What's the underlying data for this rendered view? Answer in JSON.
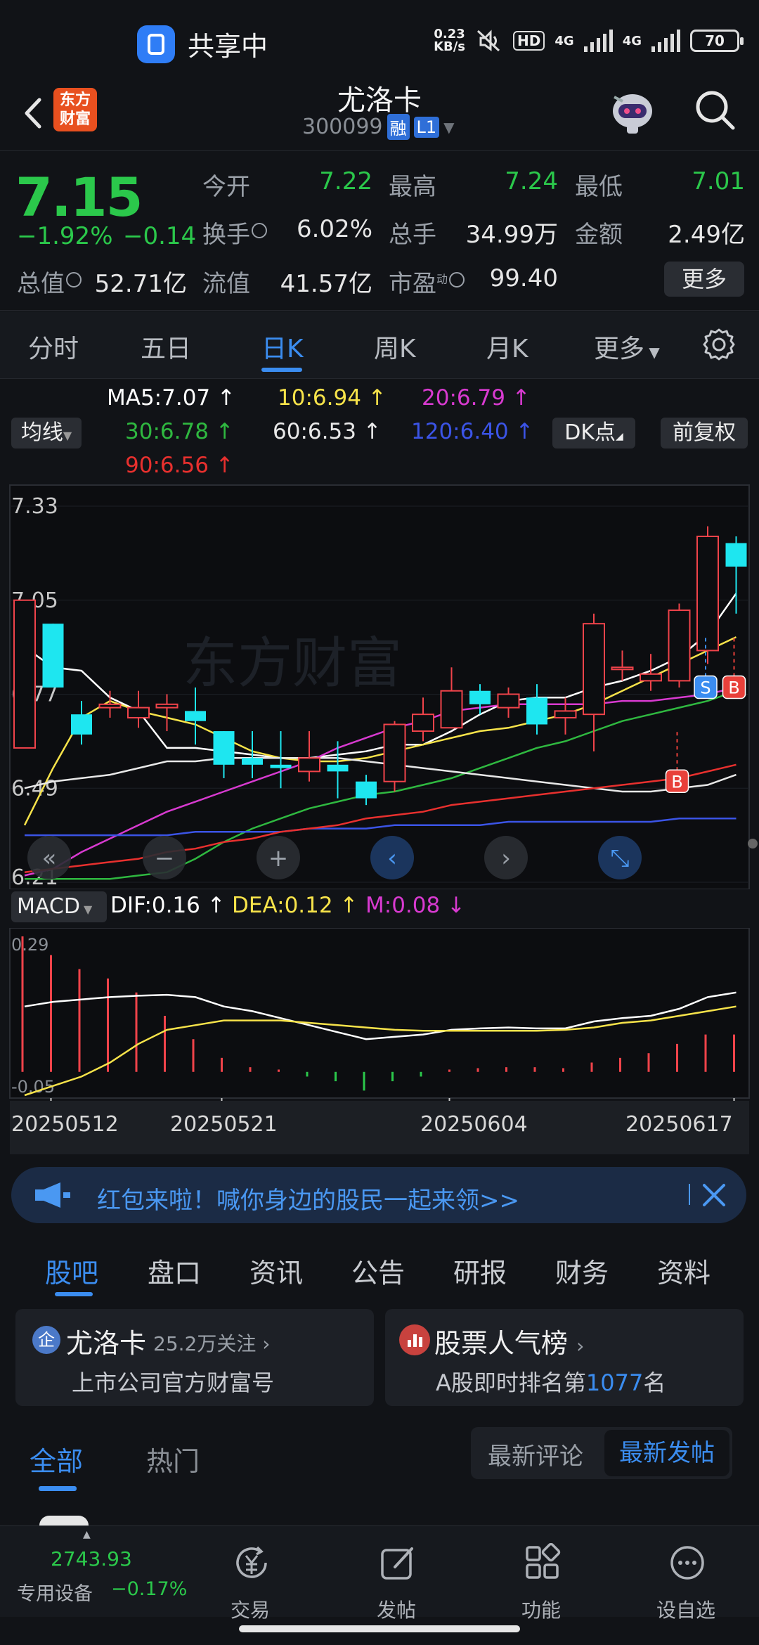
{
  "status_bar": {
    "share_label": "共享中",
    "net_speed_value": "0.23",
    "net_speed_unit": "KB/s",
    "hd_label": "HD",
    "net_type_1": "4G",
    "net_type_2": "4G",
    "battery": "70"
  },
  "header": {
    "logo_text_1": "东方",
    "logo_text_2": "财富",
    "stock_name": "尤洛卡",
    "stock_code": "300099",
    "tag_margin": "融",
    "tag_level": "L1"
  },
  "quote": {
    "price": "7.15",
    "change_pct": "−1.92%",
    "change_amt": "−0.14",
    "open_label": "今开",
    "open": "7.22",
    "high_label": "最高",
    "high": "7.24",
    "low_label": "最低",
    "low": "7.01",
    "turnover_label": "换手",
    "turnover": "6.02%",
    "volume_label": "总手",
    "volume": "34.99万",
    "amount_label": "金额",
    "amount": "2.49亿",
    "mktcap_label": "总值",
    "mktcap": "52.71亿",
    "float_label": "流值",
    "float_cap": "41.57亿",
    "pe_label": "市盈",
    "pe_sup": "动",
    "pe": "99.40",
    "more_label": "更多"
  },
  "period_tabs": [
    "分时",
    "五日",
    "日K",
    "周K",
    "月K",
    "更多"
  ],
  "ma_legend": {
    "ma_type": "均线",
    "ma5": "MA5:7.07",
    "ma10": "10:6.94",
    "ma20": "20:6.79",
    "ma30": "30:6.78",
    "ma60": "60:6.53",
    "ma120": "120:6.40",
    "ma90": "90:6.56",
    "dk_label": "DK点",
    "adjust_label": "前复权"
  },
  "colors": {
    "up": "#f0434a",
    "down": "#2bc84b",
    "candle_down": "#1ee6f0",
    "ma5": "#ffffff",
    "ma10": "#f7e34a",
    "ma20": "#d83ad0",
    "ma30": "#2fb840",
    "ma60": "#e8e8e8",
    "ma120": "#3b54e6",
    "ma90": "#e8302e",
    "accent": "#3b8df0"
  },
  "chart_data": {
    "type": "candlestick",
    "y_ticks": [
      "7.33",
      "7.05",
      "6.77",
      "6.49",
      "6.21"
    ],
    "ylim": [
      6.21,
      7.33
    ],
    "x_ticks": [
      "20250512",
      "20250521",
      "20250604",
      "20250617"
    ],
    "candles": [
      {
        "o": 6.61,
        "c": 7.05,
        "h": 7.05,
        "l": 6.61
      },
      {
        "o": 6.98,
        "c": 6.79,
        "h": 6.98,
        "l": 6.79
      },
      {
        "o": 6.71,
        "c": 6.65,
        "h": 6.75,
        "l": 6.62
      },
      {
        "o": 6.73,
        "c": 6.74,
        "h": 6.78,
        "l": 6.7
      },
      {
        "o": 6.7,
        "c": 6.73,
        "h": 6.78,
        "l": 6.67
      },
      {
        "o": 6.73,
        "c": 6.74,
        "h": 6.77,
        "l": 6.66
      },
      {
        "o": 6.72,
        "c": 6.69,
        "h": 6.79,
        "l": 6.62
      },
      {
        "o": 6.66,
        "c": 6.56,
        "h": 6.66,
        "l": 6.52
      },
      {
        "o": 6.58,
        "c": 6.56,
        "h": 6.66,
        "l": 6.52
      },
      {
        "o": 6.56,
        "c": 6.55,
        "h": 6.66,
        "l": 6.49
      },
      {
        "o": 6.54,
        "c": 6.58,
        "h": 6.66,
        "l": 6.51
      },
      {
        "o": 6.56,
        "c": 6.54,
        "h": 6.63,
        "l": 6.46
      },
      {
        "o": 6.51,
        "c": 6.46,
        "h": 6.53,
        "l": 6.44
      },
      {
        "o": 6.51,
        "c": 6.68,
        "h": 6.69,
        "l": 6.48
      },
      {
        "o": 6.66,
        "c": 6.71,
        "h": 6.76,
        "l": 6.63
      },
      {
        "o": 6.67,
        "c": 6.78,
        "h": 6.85,
        "l": 6.67
      },
      {
        "o": 6.78,
        "c": 6.74,
        "h": 6.8,
        "l": 6.71
      },
      {
        "o": 6.73,
        "c": 6.77,
        "h": 6.79,
        "l": 6.7
      },
      {
        "o": 6.76,
        "c": 6.68,
        "h": 6.8,
        "l": 6.65
      },
      {
        "o": 6.7,
        "c": 6.72,
        "h": 6.76,
        "l": 6.65
      },
      {
        "o": 6.71,
        "c": 6.98,
        "h": 7.01,
        "l": 6.6
      },
      {
        "o": 6.85,
        "c": 6.85,
        "h": 6.9,
        "l": 6.81
      },
      {
        "o": 6.81,
        "c": 6.83,
        "h": 6.89,
        "l": 6.78
      },
      {
        "o": 6.81,
        "c": 7.02,
        "h": 7.04,
        "l": 6.79
      },
      {
        "o": 6.9,
        "c": 7.24,
        "h": 7.27,
        "l": 6.86
      },
      {
        "o": 7.22,
        "c": 7.15,
        "h": 7.24,
        "l": 7.01
      }
    ],
    "series": [
      {
        "name": "MA5",
        "values": [
          6.91,
          6.85,
          6.84,
          6.76,
          6.72,
          6.61,
          6.61,
          6.6,
          6.59,
          6.58,
          6.58,
          6.59,
          6.6,
          6.62,
          6.62,
          6.66,
          6.71,
          6.75,
          6.76,
          6.76,
          6.79,
          6.81,
          6.84,
          6.88,
          6.95,
          7.07
        ]
      },
      {
        "name": "10",
        "values": [
          6.38,
          6.55,
          6.7,
          6.75,
          6.72,
          6.7,
          6.68,
          6.64,
          6.6,
          6.58,
          6.57,
          6.57,
          6.58,
          6.6,
          6.62,
          6.64,
          6.66,
          6.67,
          6.69,
          6.71,
          6.74,
          6.78,
          6.82,
          6.86,
          6.9,
          6.94
        ]
      },
      {
        "name": "20",
        "values": [
          6.23,
          6.25,
          6.3,
          6.34,
          6.38,
          6.42,
          6.45,
          6.48,
          6.51,
          6.54,
          6.57,
          6.61,
          6.64,
          6.67,
          6.69,
          6.72,
          6.73,
          6.74,
          6.74,
          6.74,
          6.74,
          6.75,
          6.75,
          6.76,
          6.77,
          6.79
        ]
      },
      {
        "name": "30",
        "values": [
          6.22,
          6.22,
          6.22,
          6.22,
          6.23,
          6.24,
          6.28,
          6.33,
          6.37,
          6.4,
          6.43,
          6.45,
          6.47,
          6.48,
          6.5,
          6.52,
          6.55,
          6.58,
          6.61,
          6.63,
          6.66,
          6.69,
          6.71,
          6.73,
          6.75,
          6.78
        ]
      },
      {
        "name": "60",
        "values": [
          6.49,
          6.51,
          6.52,
          6.53,
          6.55,
          6.57,
          6.57,
          6.58,
          6.58,
          6.58,
          6.58,
          6.58,
          6.57,
          6.56,
          6.55,
          6.54,
          6.53,
          6.52,
          6.51,
          6.5,
          6.49,
          6.48,
          6.48,
          6.49,
          6.5,
          6.53
        ]
      },
      {
        "name": "120",
        "values": [
          6.35,
          6.35,
          6.35,
          6.35,
          6.35,
          6.35,
          6.36,
          6.36,
          6.36,
          6.36,
          6.37,
          6.37,
          6.37,
          6.38,
          6.38,
          6.38,
          6.38,
          6.39,
          6.39,
          6.39,
          6.39,
          6.39,
          6.39,
          6.4,
          6.4,
          6.4
        ]
      },
      {
        "name": "90",
        "values": [
          6.24,
          6.25,
          6.26,
          6.27,
          6.28,
          6.3,
          6.31,
          6.33,
          6.34,
          6.36,
          6.37,
          6.38,
          6.4,
          6.41,
          6.42,
          6.44,
          6.45,
          6.46,
          6.47,
          6.48,
          6.49,
          6.5,
          6.51,
          6.52,
          6.54,
          6.56
        ]
      }
    ],
    "markers": [
      {
        "label": "S",
        "index": 24
      },
      {
        "label": "B",
        "index": 25
      },
      {
        "label": "B",
        "index": 23
      }
    ]
  },
  "chart_controls": [
    "«",
    "−",
    "+",
    "‹",
    "›",
    "⤡"
  ],
  "macd": {
    "type_label": "MACD",
    "dif": "DIF:0.16",
    "dea": "DEA:0.12",
    "m": "M:0.08",
    "y_top": "0.29",
    "y_bottom": "-0.05",
    "ylim": [
      -0.05,
      0.29
    ],
    "dif_values": [
      0.14,
      0.15,
      0.155,
      0.16,
      0.163,
      0.165,
      0.16,
      0.14,
      0.13,
      0.115,
      0.1,
      0.085,
      0.07,
      0.075,
      0.08,
      0.09,
      0.093,
      0.095,
      0.093,
      0.093,
      0.108,
      0.115,
      0.12,
      0.135,
      0.16,
      0.17
    ],
    "dea_values": [
      -0.05,
      -0.03,
      -0.01,
      0.02,
      0.06,
      0.09,
      0.1,
      0.11,
      0.11,
      0.11,
      0.105,
      0.1,
      0.095,
      0.09,
      0.088,
      0.088,
      0.088,
      0.088,
      0.088,
      0.09,
      0.095,
      0.105,
      0.11,
      0.12,
      0.13,
      0.14
    ],
    "m_values": [
      0.29,
      0.25,
      0.22,
      0.2,
      0.17,
      0.12,
      0.07,
      0.03,
      0.01,
      0.005,
      -0.01,
      -0.02,
      -0.04,
      -0.02,
      -0.01,
      0.005,
      0.008,
      0.01,
      0.01,
      0.008,
      0.02,
      0.03,
      0.04,
      0.06,
      0.08,
      0.08
    ]
  },
  "banner": {
    "text": "红包来啦！喊你身边的股民一起来领>>"
  },
  "section_tabs": [
    "股吧",
    "盘口",
    "资讯",
    "公告",
    "研报",
    "财务",
    "资料"
  ],
  "cards": {
    "left_badge": "企",
    "left_title": "尤洛卡",
    "left_follow": "25.2万关注",
    "left_sub": "上市公司官方财富号",
    "right_title": "股票人气榜",
    "right_sub_prefix": "A股即时排名第",
    "right_rank": "1077",
    "right_sub_suffix": "名"
  },
  "feed_tabs": {
    "all": "全部",
    "hot": "热门",
    "latest_comment": "最新评论",
    "latest_post": "最新发帖"
  },
  "bottom_nav": {
    "index_value": "2743.93",
    "index_name": "专用设备",
    "index_change": "−0.17%",
    "trade": "交易",
    "post": "发帖",
    "functions": "功能",
    "watchlist": "设自选"
  }
}
